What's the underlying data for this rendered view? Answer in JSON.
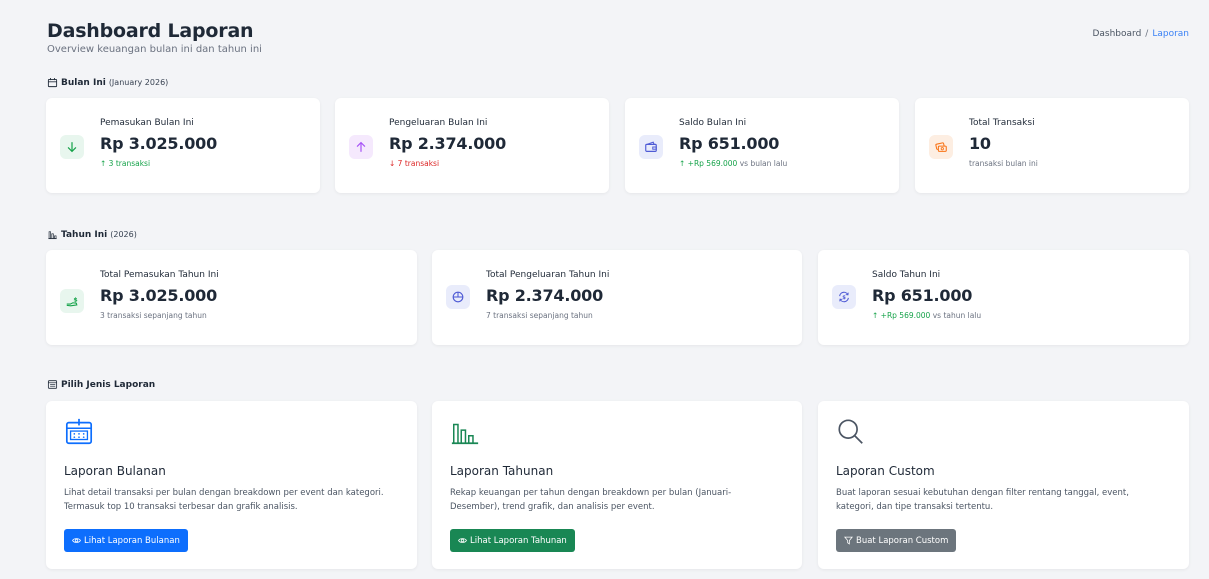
{
  "header": {
    "title": "Dashboard Laporan",
    "subtitle": "Overview keuangan bulan ini dan tahun ini"
  },
  "breadcrumb": {
    "home": "Dashboard",
    "separator": "/",
    "current": "Laporan"
  },
  "monthly": {
    "label": "Bulan Ini",
    "period": "(January 2026)",
    "cards": [
      {
        "label": "Pemasukan Bulan Ini",
        "value": "Rp 3.025.000",
        "note": "↑ 3 transaksi",
        "icon": "arrow-down-icon",
        "accent": "#16a34a"
      },
      {
        "label": "Pengeluaran Bulan Ini",
        "value": "Rp 2.374.000",
        "note": "↓ 7 transaksi",
        "icon": "arrow-up-icon",
        "accent": "#a855f7"
      },
      {
        "label": "Saldo Bulan Ini",
        "value": "Rp 651.000",
        "note_prefix": "↑ ",
        "note_highlight": "+Rp 569.000",
        "note_suffix": " vs bulan lalu",
        "icon": "wallet-icon",
        "accent": "#4f5bd5"
      },
      {
        "label": "Total Transaksi",
        "value": "10",
        "note": "transaksi bulan ini",
        "icon": "cash-icon",
        "accent": "#f97316"
      }
    ]
  },
  "yearly": {
    "label": "Tahun Ini",
    "period": "(2026)",
    "cards": [
      {
        "label": "Total Pemasukan Tahun Ini",
        "value": "Rp 3.025.000",
        "note": "3 transaksi sepanjang tahun",
        "icon": "money-hand-icon",
        "accent": "#16a34a"
      },
      {
        "label": "Total Pengeluaran Tahun Ini",
        "value": "Rp 2.374.000",
        "note": "7 transaksi sepanjang tahun",
        "icon": "pie-chart-icon",
        "accent": "#4f5bd5"
      },
      {
        "label": "Saldo Tahun Ini",
        "value": "Rp 651.000",
        "note_prefix": "↑ ",
        "note_highlight": "+Rp 569.000",
        "note_suffix": " vs tahun lalu",
        "icon": "currency-exchange-icon",
        "accent": "#4f5bd5"
      }
    ]
  },
  "reports": {
    "label": "Pilih Jenis Laporan",
    "items": [
      {
        "title": "Laporan Bulanan",
        "desc": "Lihat detail transaksi per bulan dengan breakdown per event dan kategori. Termasuk top 10 transaksi terbesar dan grafik analisis.",
        "button": "Lihat Laporan Bulanan",
        "icon": "calendar-icon",
        "color": "#0d6efd"
      },
      {
        "title": "Laporan Tahunan",
        "desc": "Rekap keuangan per tahun dengan breakdown per bulan (Januari-Desember), trend grafik, dan analisis per event.",
        "button": "Lihat Laporan Tahunan",
        "icon": "bar-chart-icon",
        "color": "#198754"
      },
      {
        "title": "Laporan Custom",
        "desc": "Buat laporan sesuai kebutuhan dengan filter rentang tanggal, event, kategori, dan tipe transaksi tertentu.",
        "button": "Buat Laporan Custom",
        "icon": "search-icon",
        "color": "#6c757d"
      }
    ]
  }
}
